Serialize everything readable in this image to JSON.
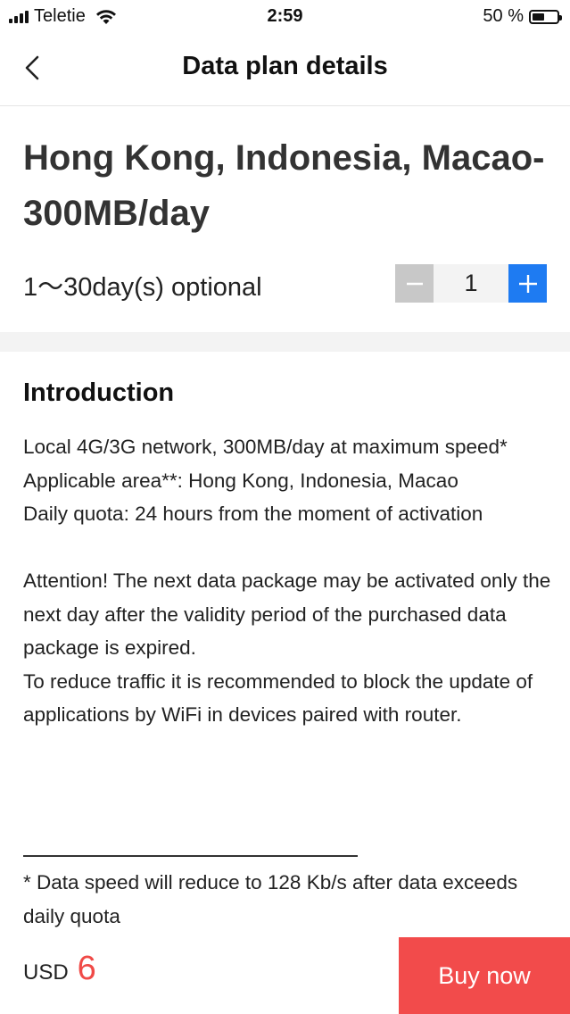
{
  "status_bar": {
    "carrier": "Teletie",
    "time": "2:59",
    "battery_percent": "50 %",
    "battery_level": 0.5
  },
  "nav": {
    "title": "Data plan details",
    "back_icon": "chevron-left-icon"
  },
  "plan": {
    "title": "Hong Kong, Indonesia, Macao-300MB/day",
    "days_label": "1～30day(s) optional",
    "quantity": "1",
    "stepper_minus_color": "#c8c8c8",
    "stepper_plus_color": "#1e7bf2"
  },
  "introduction": {
    "heading": "Introduction",
    "lines": [
      "Local 4G/3G network, 300MB/day at maximum speed*",
      "Applicable area**: Hong Kong, Indonesia, Macao",
      "Daily quota: 24 hours from the moment of activation",
      "",
      "Attention! The next data package may be activated only the next day after the validity period of the purchased data package is expired.",
      "To reduce traffic it is recommended to block the update of applications by WiFi in devices paired with router."
    ],
    "footnote": "* Data speed will reduce to 128 Kb/s after data exceeds daily quota"
  },
  "purchase": {
    "currency": "USD",
    "amount": "6",
    "buy_label": "Buy now",
    "buy_color": "#f24b4b",
    "price_color": "#f04a47"
  }
}
